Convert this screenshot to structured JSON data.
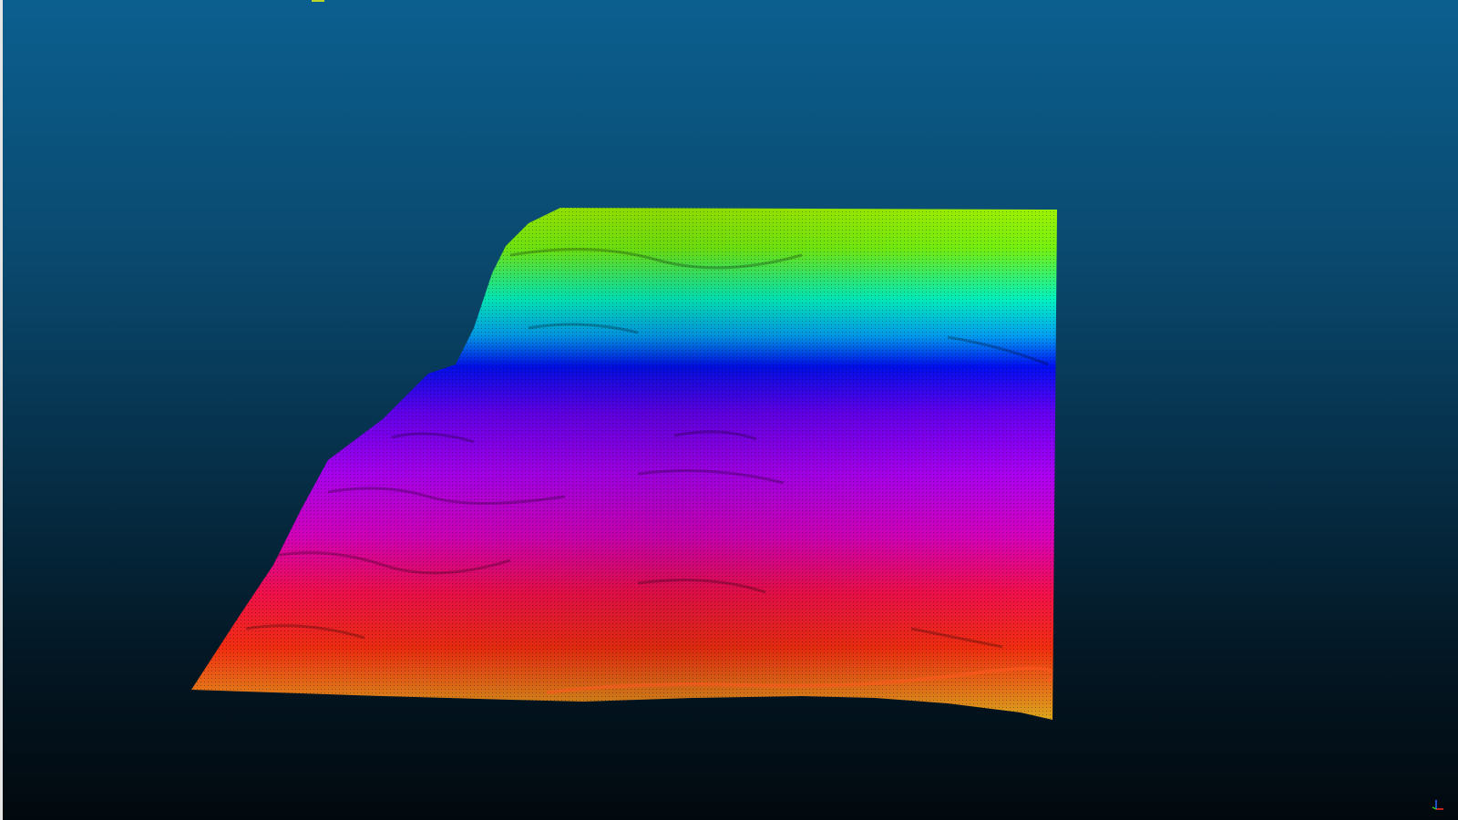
{
  "viewer": {
    "background_top": "#0b5f8f",
    "background_bottom": "#02090e",
    "point_cloud": {
      "colormap": "elevation-rainbow",
      "colormap_stops": [
        "#8fff00",
        "#00ffd0",
        "#0010ff",
        "#9000ff",
        "#d000ff",
        "#ff1050",
        "#ff3000",
        "#ffb000"
      ]
    },
    "axis_triad": {
      "x_color": "#ff2a2a",
      "y_color": "#2ad12a",
      "z_color": "#2a6bff"
    }
  }
}
